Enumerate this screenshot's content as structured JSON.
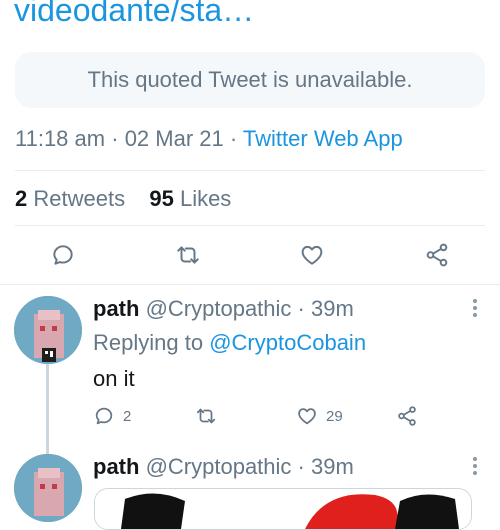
{
  "tweet": {
    "url_text": "videodante/sta…",
    "quoted_notice": "This quoted Tweet is unavailable.",
    "time": "11:18 am",
    "date": "02 Mar 21",
    "source": "Twitter Web App",
    "separator": "·",
    "retweets_count": "2",
    "retweets_label": "Retweets",
    "likes_count": "95",
    "likes_label": "Likes"
  },
  "replies": [
    {
      "name": "path",
      "handle": "@Cryptopathic",
      "time": "39m",
      "replying_prefix": "Replying to",
      "replying_to": "@CryptoCobain",
      "text": "on it",
      "reply_count": "2",
      "like_count": "29"
    },
    {
      "name": "path",
      "handle": "@Cryptopathic",
      "time": "39m"
    }
  ],
  "icons": {
    "reply": "reply-icon",
    "retweet": "retweet-icon",
    "like": "heart-icon",
    "share": "share-icon",
    "menu": "more-vertical-icon"
  },
  "colors": {
    "link": "#1b95e0",
    "muted": "#657786",
    "divider": "#e6ecf0"
  }
}
